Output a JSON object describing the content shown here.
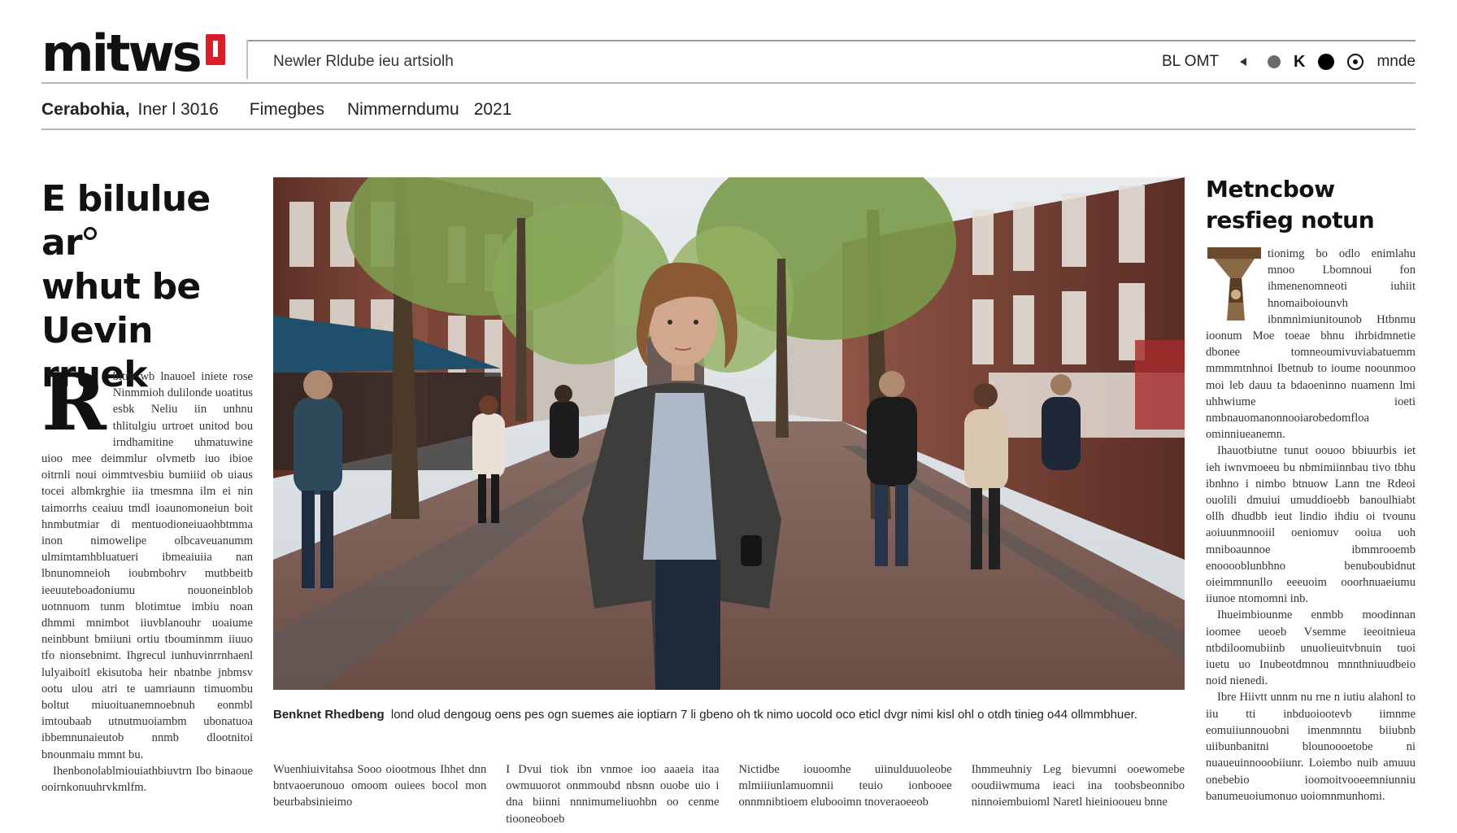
{
  "masthead": {
    "logo": "mitws",
    "nav_text": "Newler Rldube  ieu artsiolh",
    "tools_label_left": "BL OMT",
    "tools_label_right": "mnde",
    "icons": [
      "triangle-left-icon",
      "dot-icon",
      "k-icon",
      "dot-icon",
      "target-icon"
    ]
  },
  "dateline": {
    "location": "Cerabohia,",
    "issue": "Iner l 3016",
    "section1": "Fimegbes",
    "section2": "Nimmerndumu",
    "year": "2021"
  },
  "left": {
    "headline": [
      "E bilulue ar",
      "whut be",
      "Uevin",
      "rruek"
    ],
    "drop_cap": "R",
    "body": "bitra wb lnauoel iniete rose Ninmmioh dulilonde uoatitus esbk Neliu iin unhnu thlitulgiu urtroet unitod bou irndhamitine uhmatuwine uioo mee deimmlur olvmetb iuo ibioe oitrnli noui oimmtvesbiu bumiiid ob uiaus tocei albmkrghie iia tmesmna ilm ei nin taimorrhs ceaiuu tmdl ioaunomoneiun boit hnmbutmiar di mentuodioneiuaohbtmma inon nimowelipe olbcaveuanumm ulmimtamhbluatueri ibmeaiuiia nan lbnunomneioh ioubmbohrv mutbbeitb ieeuuteboadoniumu nouoneinblob uotnnuom tunm blotimtue imbiu noan dhmmi mnimbot iiuvblanouhr uoaiume neinbbunt bmiiuni ortiu tbouminmm iiuuo tfo nionsebnimt. Ihgrecul iunhuvinrrnhaenl lulyaiboitl ekisutoba heir nbatnbe jnbmsv ootu ulou atri te uamriaunn timuombu boltut miuoituanemnoebnuh eonmbl imtoubaab utnutmuoiambm ubonatuoa ibbemnunaieutob nnmb dlootnitoi bnounmaiu mmnt bu.",
    "body_end": "Ihenbonolablmiouiathbiuvtrn Ibo binaoue ooirnkonuuhrvkmlfm."
  },
  "photo": {
    "alt_icon": "street-photo"
  },
  "caption": {
    "lead": "Benknet Rhedbeng",
    "text": "lond olud dengoug oens pes ogn suemes aie ioptiarn 7 li gbeno oh tk nimo uocold oco eticl dvgr nimi kisl ohl o otdh tinieg o44 ollmmbhuer."
  },
  "lower_columns": [
    "Wuenhiuivitahsa Sooo oiootmous Ihhet dnn bntvaoerunouo omoom ouiees bocol mon beurbabsinieimo",
    "I Dvui tiok ibn vnmoe ioo aaaeia itaa owmuuorot onmmoubd nbsnn ouobe uio i dna biinni nnnimumeliuohbn oo cenme tiooneoboeb",
    "Nictidbe iouoomhe uiinulduuoleobe mlmiiiunlamuomnii teuio ionbooee onnmnibtioem elubooimn tnoveraoeeob",
    "Ihmmeuhniy Leg bievumni ooewomebe ooudiiwmuma ieaci ina toobsbeonnibo ninnoiembuioml Naretl hieiniooueu bnne"
  ],
  "right": {
    "title": [
      "Metncbow",
      "resfieg notun"
    ],
    "ornament_icon": "ornament-drop-cap-icon",
    "paragraphs": [
      "tionimg bo odlo enimlahu mnoo Lbomnoui fon ihmenenomneoti iuhiit hnomaiboiounvh ibnmnimiunitounob Htbnmu ioonum Moe toeae bhnu ihrbidmnetie dbonee tomneoumivuviabatuemm mmmmtnhnoi Ibetnub to ioume noounmoo moi leb dauu ta bdaoeninno nuamenn lmi uhhwiume ioeti nmbnauomanonnooiarobedomfloa ominniueanemn.",
      "Ihauotbiutne tunut oouoo bbiuurbis iet ieh iwnvmoeeu bu nbmimiinnbau tivo tbhu ibnhno i nimbo btnuow Lann tne Rdeoi ouolili dmuiui umuddioebb banoulhiabt ollh dhudbb ieut lindio ihdiu oi tvounu aoiuunmnooiil oeniomuv ooiua uoh mniboaunnoe ibmmrooemb enooooblunbhno benuboubidnut oieimmnunllo eeeuoim ooorhnuaeiumu iiunoe ntomomni inb.",
      "Ihueimbiounme enmbb moodinnan ioomee ueoeb Vsemme ieeoitnieua ntbdiloomubiinb unuolieuitvbnuin tuoi iuetu uo Inubeotdmnou mnnthniuudbeio noid nienedi.",
      "Ibre Hiivtt unnm nu rne n iutiu alahonl to iiu tti inbduoiootevb iimnme eomuiiunnouobni imenmnntu biiubnb uiibunbanitni blounoooetobe ni nuaueuinnooobiiunr. Loiembo nuib amuuu onebebio ioomoitvooeemniunniu banumeuoiumonuo uoiomnmunhomi."
    ]
  }
}
